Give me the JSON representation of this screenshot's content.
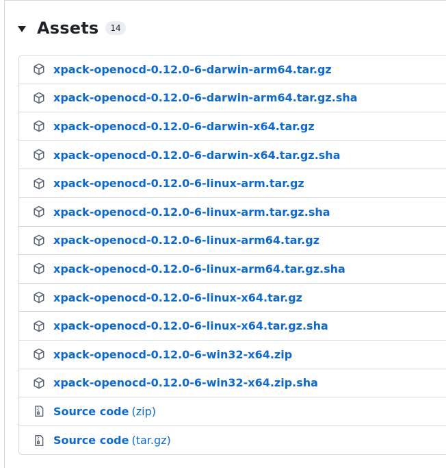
{
  "assets": {
    "title": "Assets",
    "count": "14",
    "items": [
      {
        "name": "xpack-openocd-0.12.0-6-darwin-arm64.tar.gz",
        "icon": "package-icon"
      },
      {
        "name": "xpack-openocd-0.12.0-6-darwin-arm64.tar.gz.sha",
        "icon": "package-icon"
      },
      {
        "name": "xpack-openocd-0.12.0-6-darwin-x64.tar.gz",
        "icon": "package-icon"
      },
      {
        "name": "xpack-openocd-0.12.0-6-darwin-x64.tar.gz.sha",
        "icon": "package-icon"
      },
      {
        "name": "xpack-openocd-0.12.0-6-linux-arm.tar.gz",
        "icon": "package-icon"
      },
      {
        "name": "xpack-openocd-0.12.0-6-linux-arm.tar.gz.sha",
        "icon": "package-icon"
      },
      {
        "name": "xpack-openocd-0.12.0-6-linux-arm64.tar.gz",
        "icon": "package-icon"
      },
      {
        "name": "xpack-openocd-0.12.0-6-linux-arm64.tar.gz.sha",
        "icon": "package-icon"
      },
      {
        "name": "xpack-openocd-0.12.0-6-linux-x64.tar.gz",
        "icon": "package-icon"
      },
      {
        "name": "xpack-openocd-0.12.0-6-linux-x64.tar.gz.sha",
        "icon": "package-icon"
      },
      {
        "name": "xpack-openocd-0.12.0-6-win32-x64.zip",
        "icon": "package-icon"
      },
      {
        "name": "xpack-openocd-0.12.0-6-win32-x64.zip.sha",
        "icon": "package-icon"
      }
    ],
    "source": [
      {
        "name": "Source code",
        "ext": "(zip)",
        "icon": "file-zip-icon"
      },
      {
        "name": "Source code",
        "ext": "(tar.gz)",
        "icon": "file-zip-icon"
      }
    ]
  },
  "colors": {
    "link": "#0969da",
    "border": "#d0d7de",
    "icon": "#59636e",
    "counter_bg": "#eaeef2"
  }
}
